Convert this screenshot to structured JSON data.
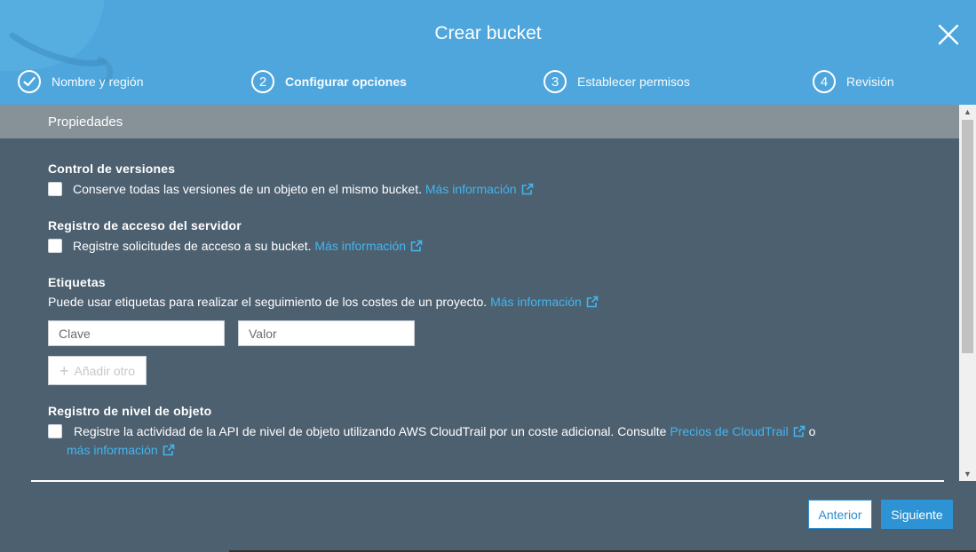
{
  "dialog": {
    "title": "Crear bucket",
    "close_icon": "close-icon"
  },
  "steps": [
    {
      "number": "",
      "label": "Nombre y región",
      "state": "completed",
      "icon": "check-circle-icon"
    },
    {
      "number": "2",
      "label": "Configurar opciones",
      "state": "active"
    },
    {
      "number": "3",
      "label": "Establecer permisos",
      "state": "pending"
    },
    {
      "number": "4",
      "label": "Revisión",
      "state": "pending"
    }
  ],
  "properties": {
    "header": "Propiedades",
    "versioning": {
      "title": "Control de versiones",
      "text": "Conserve todas las versiones de un objeto en el mismo bucket.",
      "link": "Más información",
      "checked": false
    },
    "server_access_logging": {
      "title": "Registro de acceso del servidor",
      "text": "Registre solicitudes de acceso a su bucket.",
      "link": "Más información",
      "checked": false
    },
    "tags": {
      "title": "Etiquetas",
      "text": "Puede usar etiquetas para realizar el seguimiento de los costes de un proyecto.",
      "link": "Más información",
      "key_placeholder": "Clave",
      "value_placeholder": "Valor",
      "add_label": "Añadir otro"
    },
    "object_logging": {
      "title": "Registro de nivel de objeto",
      "text": "Registre la actividad de la API de nivel de objeto utilizando AWS CloudTrail por un coste adicional. Consulte",
      "pricing_link": "Precios de CloudTrail",
      "conjunction": "o",
      "more_link": "más información",
      "checked": false
    }
  },
  "footer": {
    "previous_label": "Anterior",
    "next_label": "Siguiente"
  },
  "colors": {
    "header_bg": "#4ea6dc",
    "body_bg": "#4d6070",
    "propbar_bg": "#879298",
    "link": "#42b5ef",
    "primary": "#2e93d4"
  }
}
